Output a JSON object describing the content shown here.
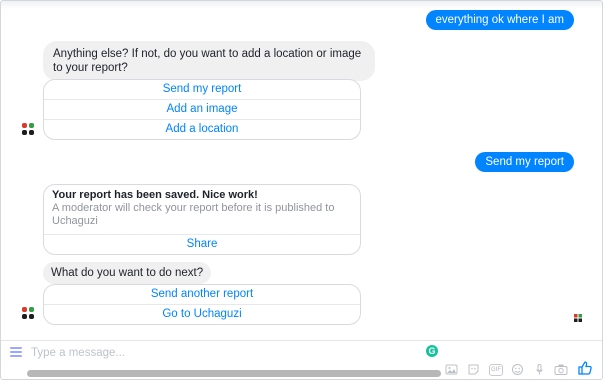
{
  "messages": {
    "user_1": "everything ok where I am",
    "bot_prompt": "Anything else? If not, do you want to add a location or image to your report?",
    "quick_replies_1": [
      "Send my report",
      "Add an image",
      "Add a location"
    ],
    "user_2": "Send my report",
    "card": {
      "title": "Your report has been saved. Nice work!",
      "subtitle": "A moderator will check your report before it is published to Uchaguzi",
      "button": "Share"
    },
    "bot_next": "What do you want to do next?",
    "quick_replies_2": [
      "Send another report",
      "Go to Uchaguzi"
    ]
  },
  "composer": {
    "placeholder": "Type a message...",
    "gif_label": "GIF"
  },
  "colors": {
    "accent": "#0084ff",
    "bot_bubble": "#f1f0f0",
    "grammarly": "#15c39a"
  },
  "icons": [
    "menu-icon",
    "grammarly-icon",
    "image-icon",
    "sticker-icon",
    "gif-icon",
    "emoji-icon",
    "microphone-icon",
    "camera-icon",
    "thumbs-up-icon",
    "bot-avatar-icon"
  ]
}
